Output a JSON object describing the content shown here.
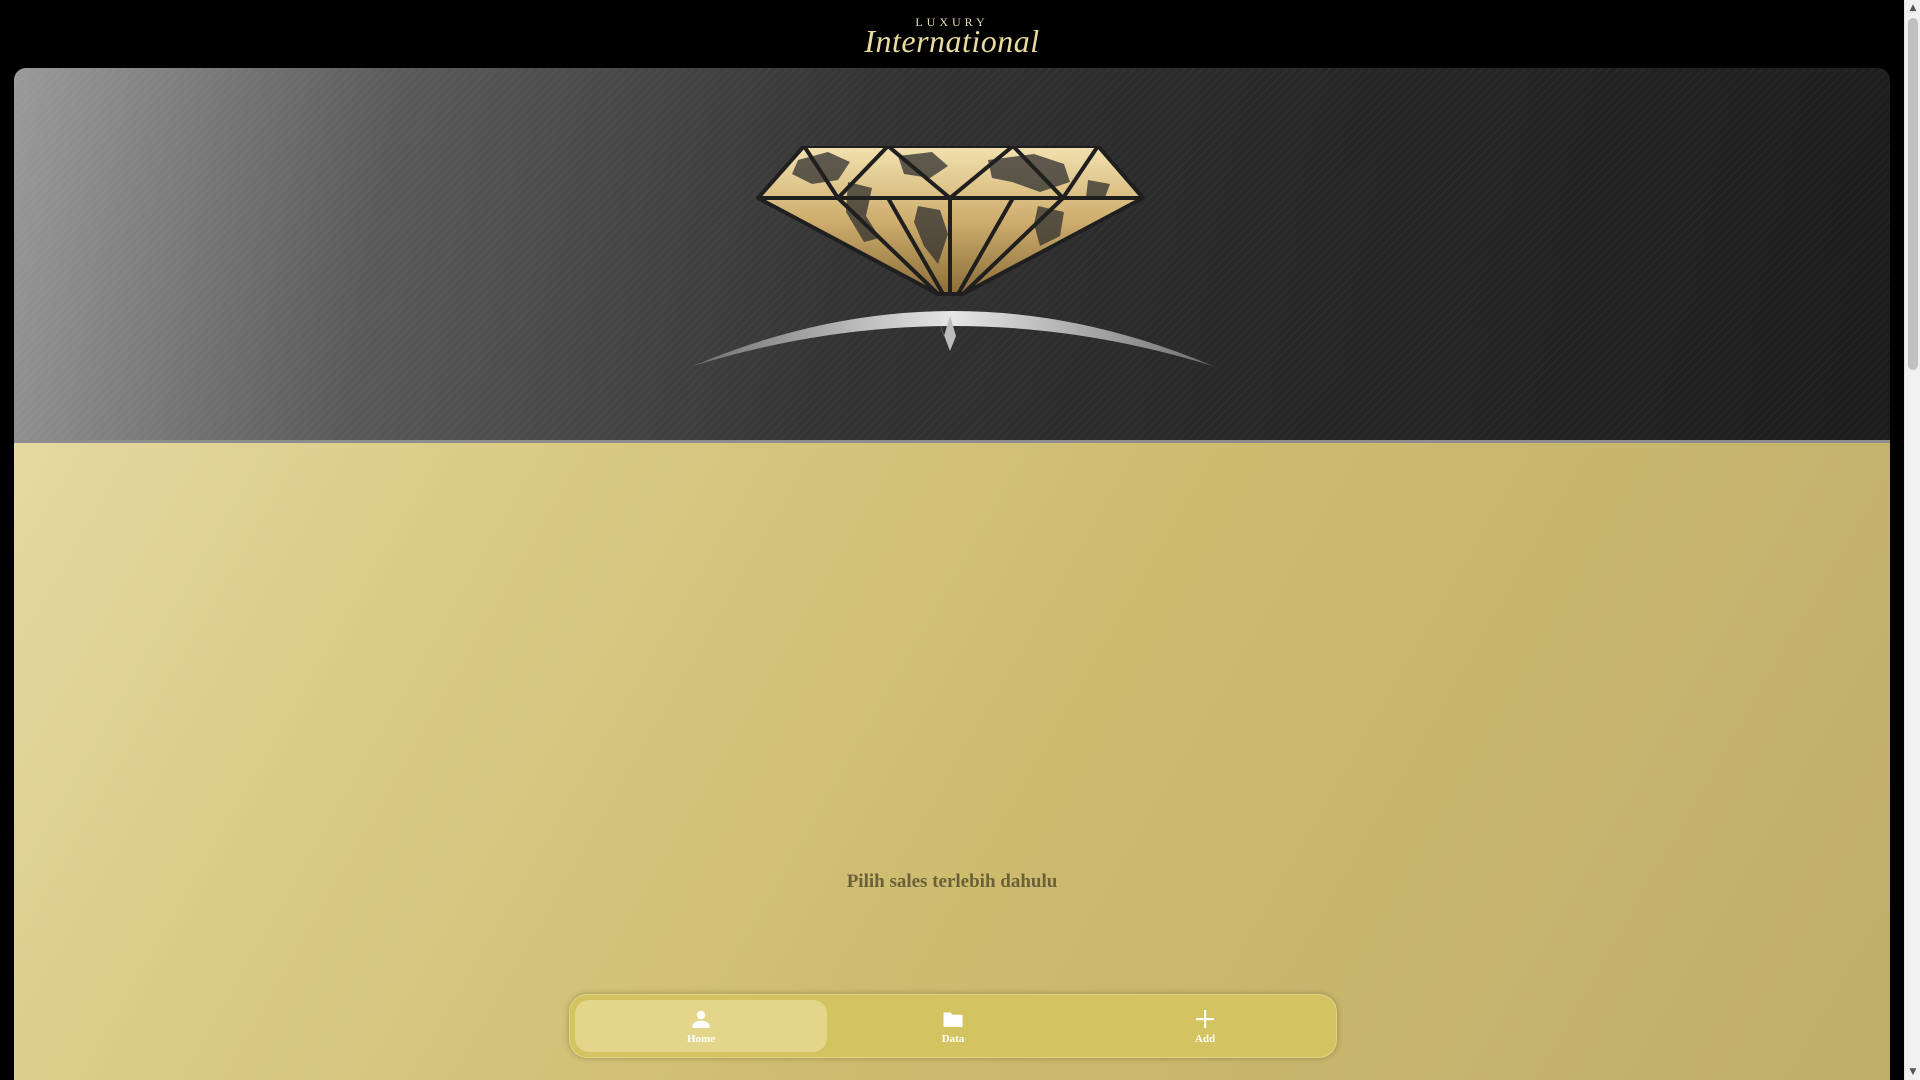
{
  "header": {
    "brand_top": "LUXURY",
    "brand_main": "International"
  },
  "main": {
    "prompt": "Pilih sales terlebih dahulu"
  },
  "bottom_nav": {
    "items": [
      {
        "label": "Home",
        "icon": "person-icon",
        "active": true
      },
      {
        "label": "Data",
        "icon": "folder-icon",
        "active": false
      },
      {
        "label": "Add",
        "icon": "plus-icon",
        "active": false
      }
    ]
  },
  "colors": {
    "gold": "#d4c461",
    "gold_light": "#e3d68a",
    "text_dark": "#6b6038",
    "dark": "#262626"
  }
}
